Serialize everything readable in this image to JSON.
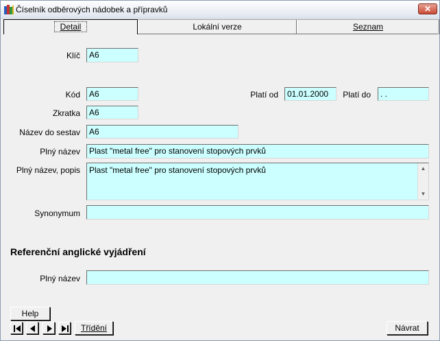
{
  "window": {
    "title": "Číselník odběrových nádobek a přípravků",
    "close_symbol": "✕"
  },
  "tabs": [
    {
      "label": "Detail"
    },
    {
      "label": "Lokální verze"
    },
    {
      "label": "Seznam"
    }
  ],
  "form": {
    "klic": {
      "label": "Klíč",
      "value": "A6"
    },
    "kod": {
      "label": "Kód",
      "value": "A6"
    },
    "plati_od": {
      "label": "Platí od",
      "value": "01.01.2000"
    },
    "plati_do": {
      "label": "Platí do",
      "value": " .  ."
    },
    "zkratka": {
      "label": "Zkratka",
      "value": "A6"
    },
    "nazev_do_sestav": {
      "label": "Název do sestav",
      "value": "A6"
    },
    "plny_nazev": {
      "label": "Plný název",
      "value": "Plast \"metal free\" pro stanovení stopových prvků"
    },
    "plny_nazev_popis": {
      "label": "Plný název, popis",
      "value": "Plast \"metal free\" pro stanovení stopových prvků"
    },
    "synonymum": {
      "label": "Synonymum",
      "value": ""
    }
  },
  "reference": {
    "section_title": "Referenční anglické vyjádření",
    "plny_nazev": {
      "label": "Plný název",
      "value": ""
    }
  },
  "buttons": {
    "help": "Help",
    "trideni": "Třídění",
    "navrat": "Návrat"
  },
  "colors": {
    "field_bg": "#ccffff",
    "window_bg": "#f0f0f0"
  }
}
